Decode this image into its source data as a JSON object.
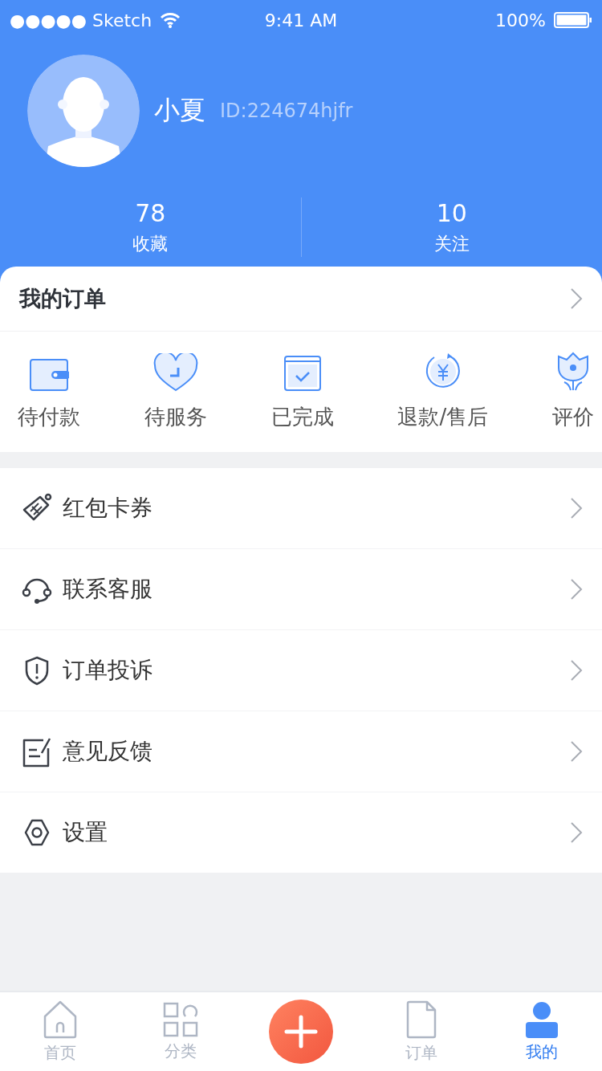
{
  "status_bar": {
    "carrier": "●●●●● Sketch",
    "time": "9:41 AM",
    "battery": "100%"
  },
  "profile": {
    "name": "小夏",
    "id": "ID:224674hjfr"
  },
  "stats": [
    {
      "value": "78",
      "label": "收藏"
    },
    {
      "value": "10",
      "label": "关注"
    }
  ],
  "orders": {
    "title": "我的订单",
    "items": [
      {
        "label": "待付款"
      },
      {
        "label": "待服务"
      },
      {
        "label": "已完成"
      },
      {
        "label": "退款/售后"
      },
      {
        "label": "评价"
      }
    ]
  },
  "menu": [
    {
      "label": "红包卡券"
    },
    {
      "label": "联系客服"
    },
    {
      "label": "订单投诉"
    },
    {
      "label": "意见反馈"
    },
    {
      "label": "设置"
    }
  ],
  "tab_bar": [
    {
      "kind": "tab",
      "label": "首页",
      "selected": false
    },
    {
      "kind": "tab",
      "label": "分类",
      "selected": false
    },
    {
      "kind": "add"
    },
    {
      "kind": "tab",
      "label": "订单",
      "selected": false
    },
    {
      "kind": "tab",
      "label": "我的",
      "selected": true
    }
  ]
}
